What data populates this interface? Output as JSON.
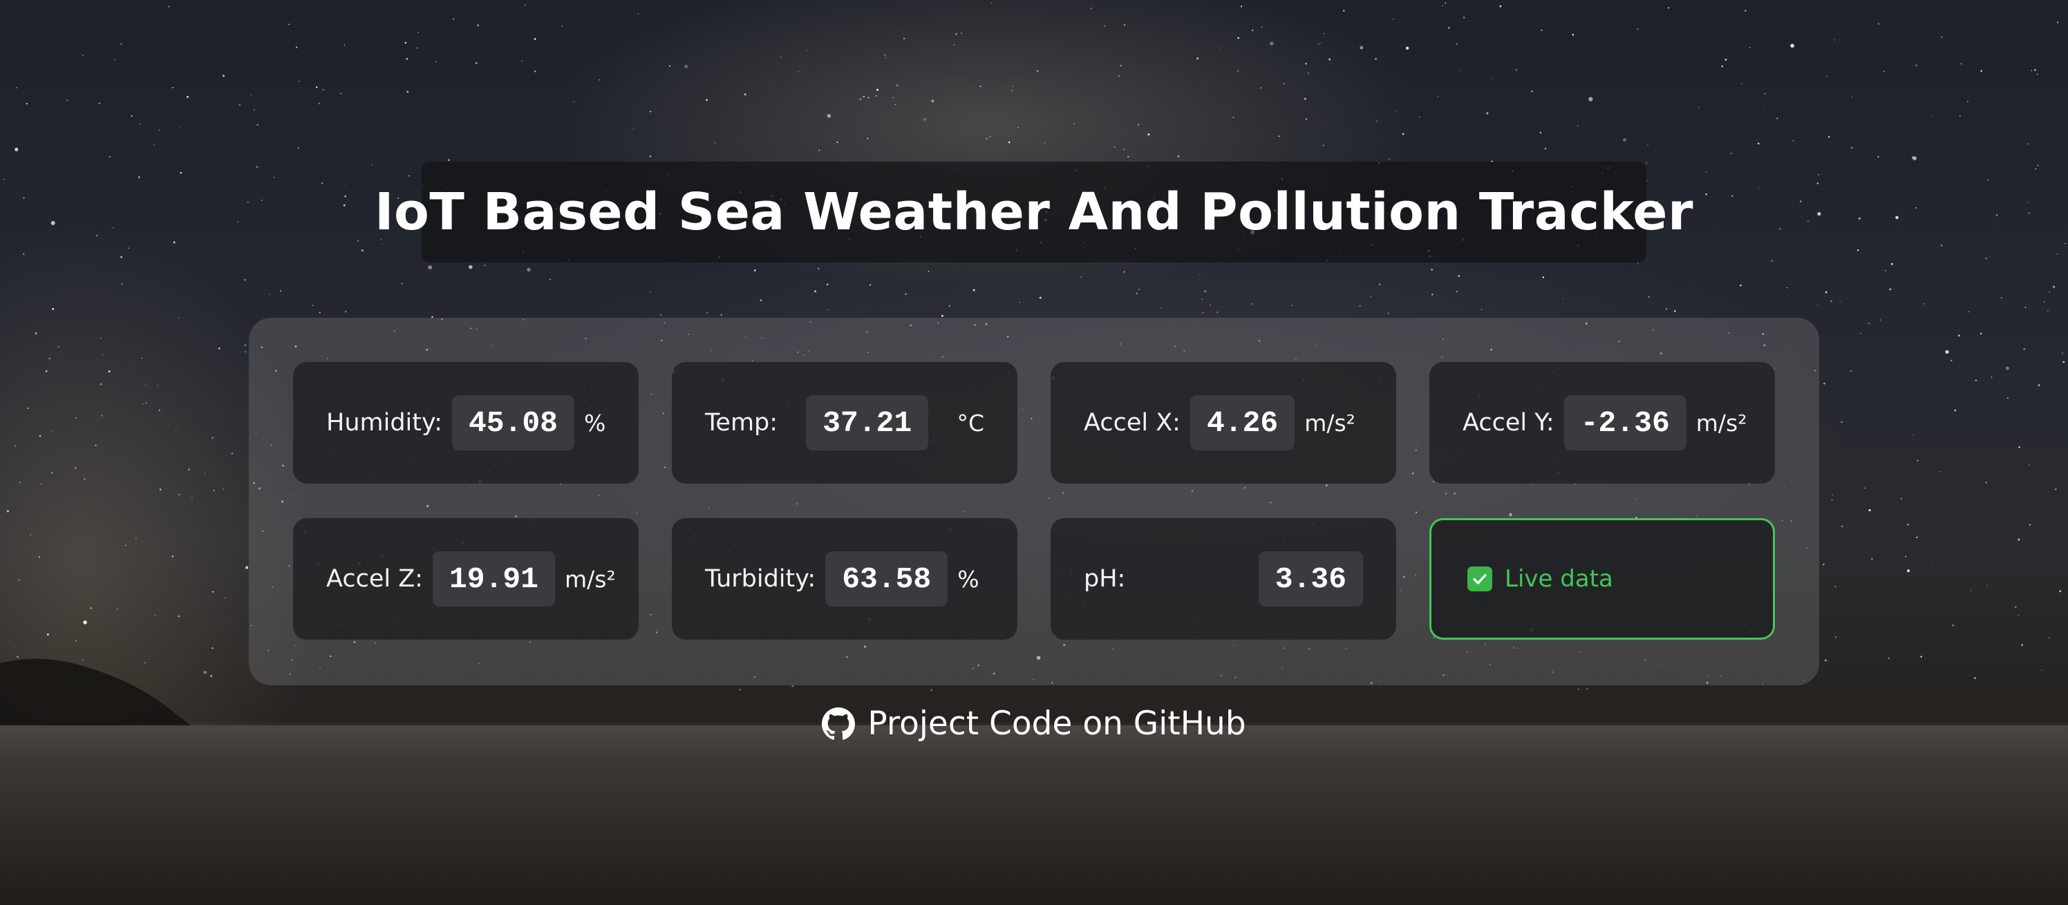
{
  "page": {
    "title": "IoT Based Sea Weather And Pollution Tracker"
  },
  "readings": {
    "humidity": {
      "label": "Humidity:",
      "value": "45.08",
      "unit": "%"
    },
    "temp": {
      "label": "Temp:",
      "value": "37.21",
      "unit": "°C"
    },
    "accel_x": {
      "label": "Accel X:",
      "value": "4.26",
      "unit": "m/s²"
    },
    "accel_y": {
      "label": "Accel Y:",
      "value": "-2.36",
      "unit": "m/s²"
    },
    "accel_z": {
      "label": "Accel Z:",
      "value": "19.91",
      "unit": "m/s²"
    },
    "turbidity": {
      "label": "Turbidity:",
      "value": "63.58",
      "unit": "%"
    },
    "ph": {
      "label": "pH:",
      "value": "3.36"
    }
  },
  "live_data": {
    "label": "Live data",
    "checked": true,
    "accent_color": "#43c55a"
  },
  "footer": {
    "link_label": "Project Code on GitHub",
    "icon": "github-icon"
  }
}
